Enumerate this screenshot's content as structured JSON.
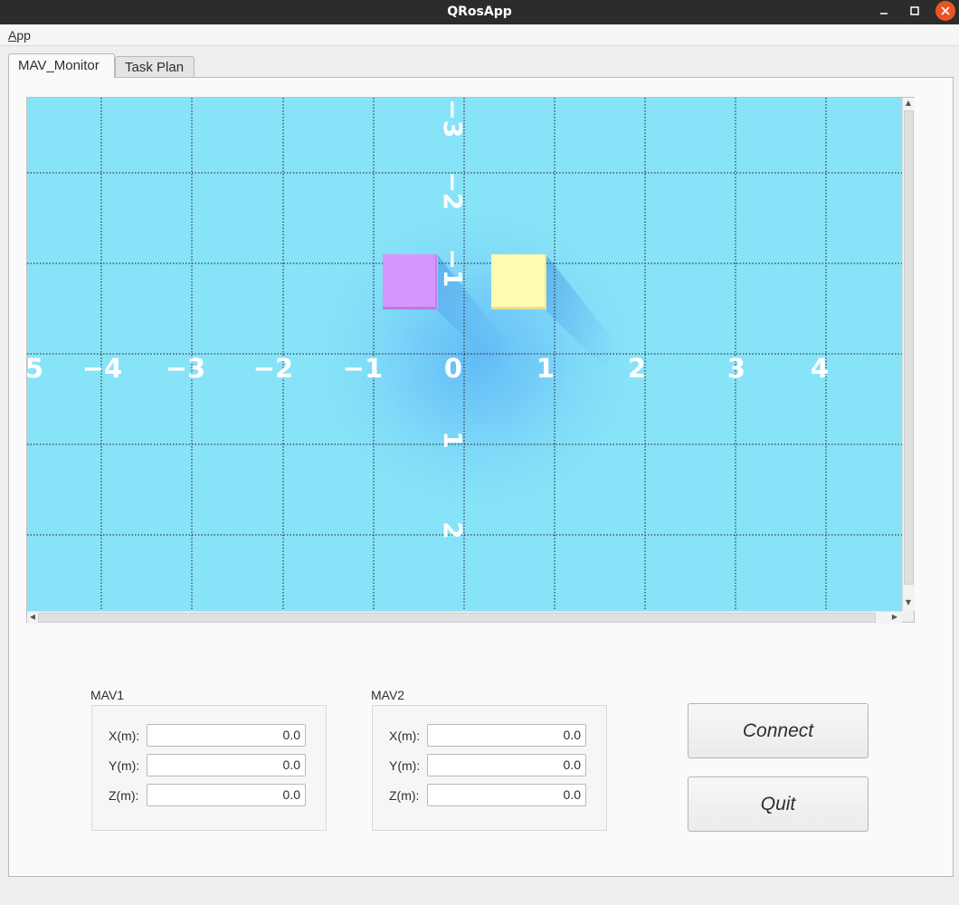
{
  "window": {
    "title": "QRosApp"
  },
  "menubar": {
    "items": [
      {
        "label": "App"
      }
    ]
  },
  "tabs": [
    {
      "label": "MAV_Monitor"
    },
    {
      "label": "Task Plan"
    }
  ],
  "map": {
    "background_color": "#87E4F8",
    "x_tick_labels": [
      "5",
      "−4",
      "−3",
      "−2",
      "−1",
      "0",
      "1",
      "2",
      "3",
      "4"
    ],
    "y_tick_labels": [
      "−3",
      "−2",
      "−1",
      "1",
      "2"
    ],
    "objects": [
      {
        "name": "mav1-marker",
        "color": "#D597FB"
      },
      {
        "name": "mav2-marker",
        "color": "#FFFBB0"
      }
    ]
  },
  "mav_panels": [
    {
      "title": "MAV1",
      "fields": [
        {
          "label": "X(m):",
          "value": "0.0"
        },
        {
          "label": "Y(m):",
          "value": "0.0"
        },
        {
          "label": "Z(m):",
          "value": "0.0"
        }
      ]
    },
    {
      "title": "MAV2",
      "fields": [
        {
          "label": "X(m):",
          "value": "0.0"
        },
        {
          "label": "Y(m):",
          "value": "0.0"
        },
        {
          "label": "Z(m):",
          "value": "0.0"
        }
      ]
    }
  ],
  "buttons": {
    "connect": "Connect",
    "quit": "Quit"
  }
}
